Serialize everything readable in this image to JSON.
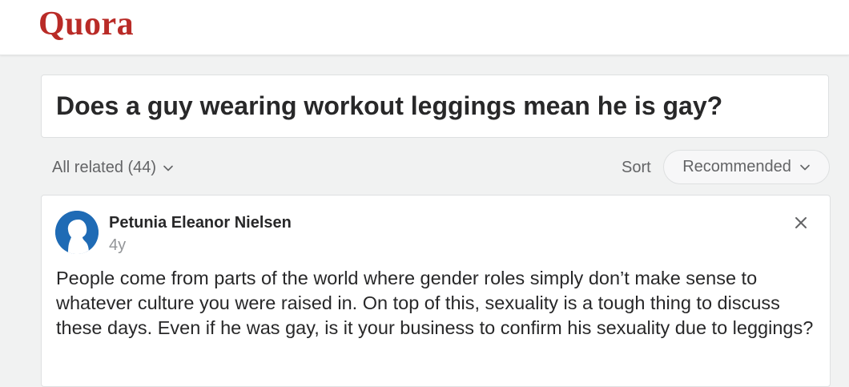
{
  "brand": {
    "logo_text": "Quora",
    "accent_color": "#b92b27"
  },
  "question": {
    "title": "Does a guy wearing workout leggings mean he is gay?"
  },
  "filters": {
    "related_label": "All related (44)",
    "sort_label": "Sort",
    "sort_value": "Recommended"
  },
  "answer": {
    "author_name": "Petunia Eleanor Nielsen",
    "time_ago": "4y",
    "avatar_icon": "profile-silhouette-icon",
    "avatar_color": "#1f6bb5",
    "close_icon": "close-icon",
    "text": "People come from parts of the world where gender roles simply don’t make sense to whatever culture you were raised in. On top of this, sexuality is a tough thing to discuss these days. Even if he was gay, is it your business to confirm his sexuality due to leggings?"
  }
}
